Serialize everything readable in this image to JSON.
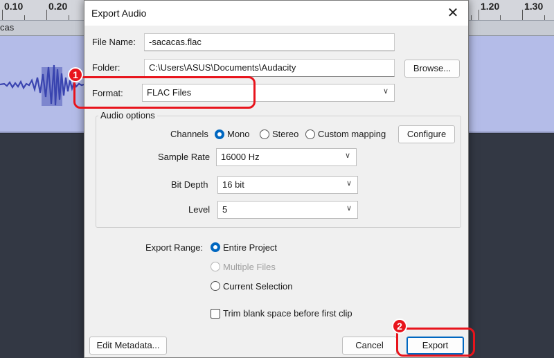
{
  "ruler": {
    "labels": [
      "0.10",
      "0.20",
      "1.20",
      "1.30"
    ]
  },
  "track": {
    "name": "cas"
  },
  "dialog": {
    "title": "Export Audio",
    "close_icon": "✕",
    "file_name_label": "File Name:",
    "file_name_value": "-sacacas.flac",
    "folder_label": "Folder:",
    "folder_value": "C:\\Users\\ASUS\\Documents\\Audacity",
    "browse_label": "Browse...",
    "format_label": "Format:",
    "format_value": "FLAC Files",
    "audio_options_title": "Audio options",
    "channels_label": "Channels",
    "channel_options": [
      "Mono",
      "Stereo",
      "Custom mapping"
    ],
    "channel_selected": "Mono",
    "configure_label": "Configure",
    "sample_rate_label": "Sample Rate",
    "sample_rate_value": "16000 Hz",
    "bit_depth_label": "Bit Depth",
    "bit_depth_value": "16 bit",
    "level_label": "Level",
    "level_value": "5",
    "export_range_label": "Export Range:",
    "range_options": [
      "Entire Project",
      "Multiple Files",
      "Current Selection"
    ],
    "range_selected": "Entire Project",
    "trim_label": "Trim blank space before first clip",
    "trim_checked": false,
    "edit_metadata_label": "Edit Metadata...",
    "cancel_label": "Cancel",
    "export_label": "Export"
  },
  "annotations": {
    "badge_1": "1",
    "badge_2": "2",
    "color": "#e8141c"
  },
  "colors": {
    "accent": "#0067c0",
    "track_fill": "#b4bce8",
    "wave": "#3a44b0"
  }
}
